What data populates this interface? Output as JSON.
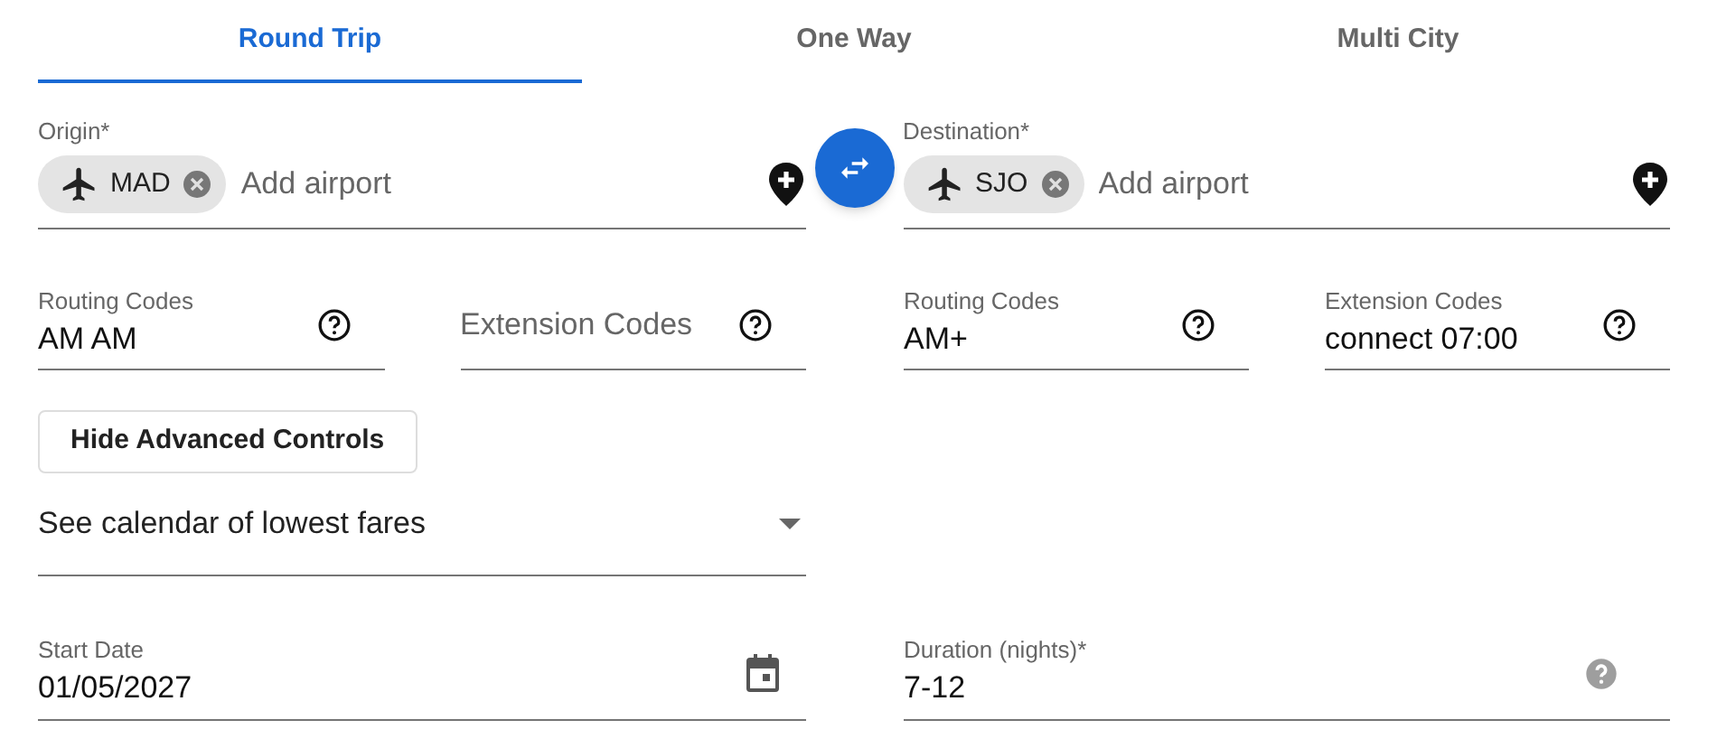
{
  "tabs": [
    {
      "label": "Round Trip",
      "selected": true
    },
    {
      "label": "One Way",
      "selected": false
    },
    {
      "label": "Multi City",
      "selected": false
    }
  ],
  "airports": [
    {
      "label": "Origin*",
      "chips": [
        {
          "code": "MAD"
        }
      ],
      "placeholder": "Add airport"
    },
    {
      "label": "Destination*",
      "chips": [
        {
          "code": "SJO"
        }
      ],
      "placeholder": "Add airport"
    }
  ],
  "code_fields": [
    {
      "label": "Routing Codes",
      "value": "AM AM"
    },
    {
      "placeholder": "Extension Codes"
    },
    {
      "label": "Routing Codes",
      "value": "AM+"
    },
    {
      "label": "Extension Codes",
      "value": "connect 07:00"
    }
  ],
  "advanced_button": "Hide Advanced Controls",
  "calendar_select": {
    "value": "See calendar of lowest fares"
  },
  "start_date": {
    "label": "Start Date",
    "value": "01/05/2027"
  },
  "duration": {
    "label": "Duration (nights)*",
    "value": "7-12"
  }
}
